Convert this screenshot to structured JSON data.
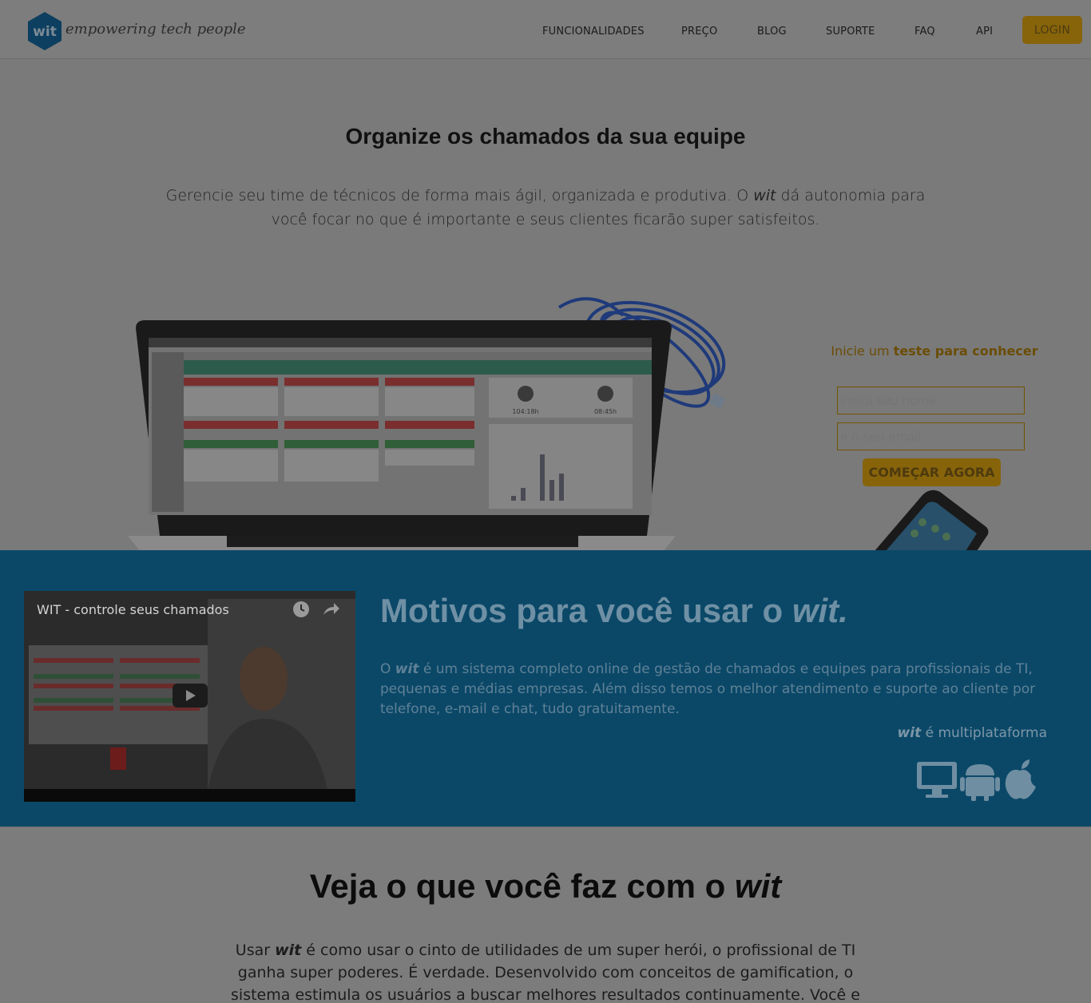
{
  "header": {
    "logo_text": "wit",
    "tagline": "empowering tech people",
    "nav": [
      "FUNCIONALIDADES",
      "PREÇO",
      "BLOG",
      "SUPORTE",
      "FAQ",
      "API"
    ],
    "login_label": "LOGIN"
  },
  "hero": {
    "title": "Organize os chamados da sua equipe",
    "text_before": "Gerencie seu time de técnicos de forma mais ágil, organizada e produtiva. O ",
    "text_brand": "wit",
    "text_after": " dá autonomia para você focar no que é importante e seus clientes ficarão super satisfeitos.",
    "laptop_stats": [
      "104:18h",
      "08:45h"
    ]
  },
  "signup": {
    "caption_pre": "Inicie um ",
    "caption_bold": "teste para conhecer",
    "name_placeholder": "insira seu nome",
    "email_placeholder": "e o seu email",
    "cta_label": "COMEÇAR AGORA"
  },
  "band": {
    "video_title": "WIT - controle seus chamados",
    "title_pre": "Motivos para você usar o ",
    "title_brand": "wit.",
    "text_pre": "O ",
    "text_brand": "wit",
    "text_after": " é um sistema completo online de gestão de chamados e equipes para profissionais de TI, pequenas e médias empresas. Além disso temos o melhor atendimento e suporte ao cliente por telefone, e-mail e chat, tudo gratuitamente.",
    "multi_brand": "wit",
    "multi_after": " é multiplataforma",
    "platform_icons": [
      "desktop-icon",
      "android-icon",
      "apple-icon"
    ]
  },
  "lower": {
    "title_pre": "Veja o que você faz com o ",
    "title_brand": "wit",
    "text_pre": "Usar ",
    "text_brand": "wit",
    "text_after": " é como usar o cinto de utilidades de um super herói, o profissional de TI ganha super poderes. É verdade. Desenvolvido com conceitos de gamification, o sistema estimula os usuários a buscar melhores resultados continuamente. Você e sua empresa se tornarão"
  },
  "colors": {
    "brand_blue": "#0b4868",
    "accent_gold": "#87640a"
  }
}
